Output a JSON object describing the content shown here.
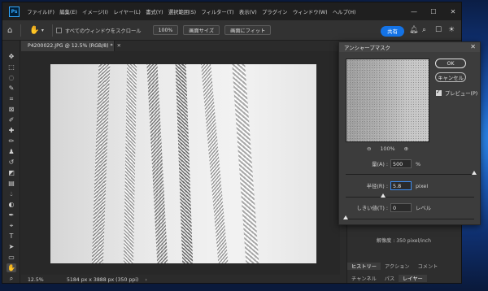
{
  "app": {
    "logo": "Ps",
    "menu": [
      "ファイル(F)",
      "編集(E)",
      "イメージ(I)",
      "レイヤー(L)",
      "書式(Y)",
      "選択範囲(S)",
      "フィルター(T)",
      "表示(V)",
      "プラグイン",
      "ウィンドウ(W)",
      "ヘルプ(H)"
    ],
    "window_controls": {
      "minimize": "—",
      "maximize": "☐",
      "close": "✕"
    }
  },
  "options_bar": {
    "scroll_all_label": "すべてのウィンドウをスクロール",
    "zoom_value": "100%",
    "fit_screen_label": "画面サイズ",
    "fill_screen_label": "画面にフィット",
    "share_label": "共有"
  },
  "document": {
    "tab_title": "P4200022.JPG @ 12.5% (RGB/8) *",
    "tab_close": "✕"
  },
  "statusbar": {
    "zoom": "12.5%",
    "info": "5184 px x 3888 px (350 ppi)",
    "arrow": "›"
  },
  "dialog": {
    "title": "アンシャープマスク",
    "close": "✕",
    "zoom_level": "100%",
    "zoom_out_icon": "⊖",
    "zoom_in_icon": "⊕",
    "ok_label": "OK",
    "cancel_label": "キャンセル",
    "preview_label": "プレビュー(P)",
    "amount": {
      "label": "量(A) :",
      "value": "500",
      "unit": "%",
      "slider_fraction": 1.0
    },
    "radius": {
      "label": "半径(R) :",
      "value": "5.8",
      "unit": "pixel",
      "slider_fraction": 0.29
    },
    "threshold": {
      "label": "しきい値(T) :",
      "value": "0",
      "unit": "レベル",
      "slider_fraction": 0.0
    }
  },
  "panels": {
    "resolution_text": "解像度 : 350 pixel/inch",
    "tabs_row1": [
      "ヒストリー",
      "アクション",
      "コメント"
    ],
    "tabs_row2": [
      "チャンネル",
      "パス",
      "レイヤー"
    ]
  }
}
